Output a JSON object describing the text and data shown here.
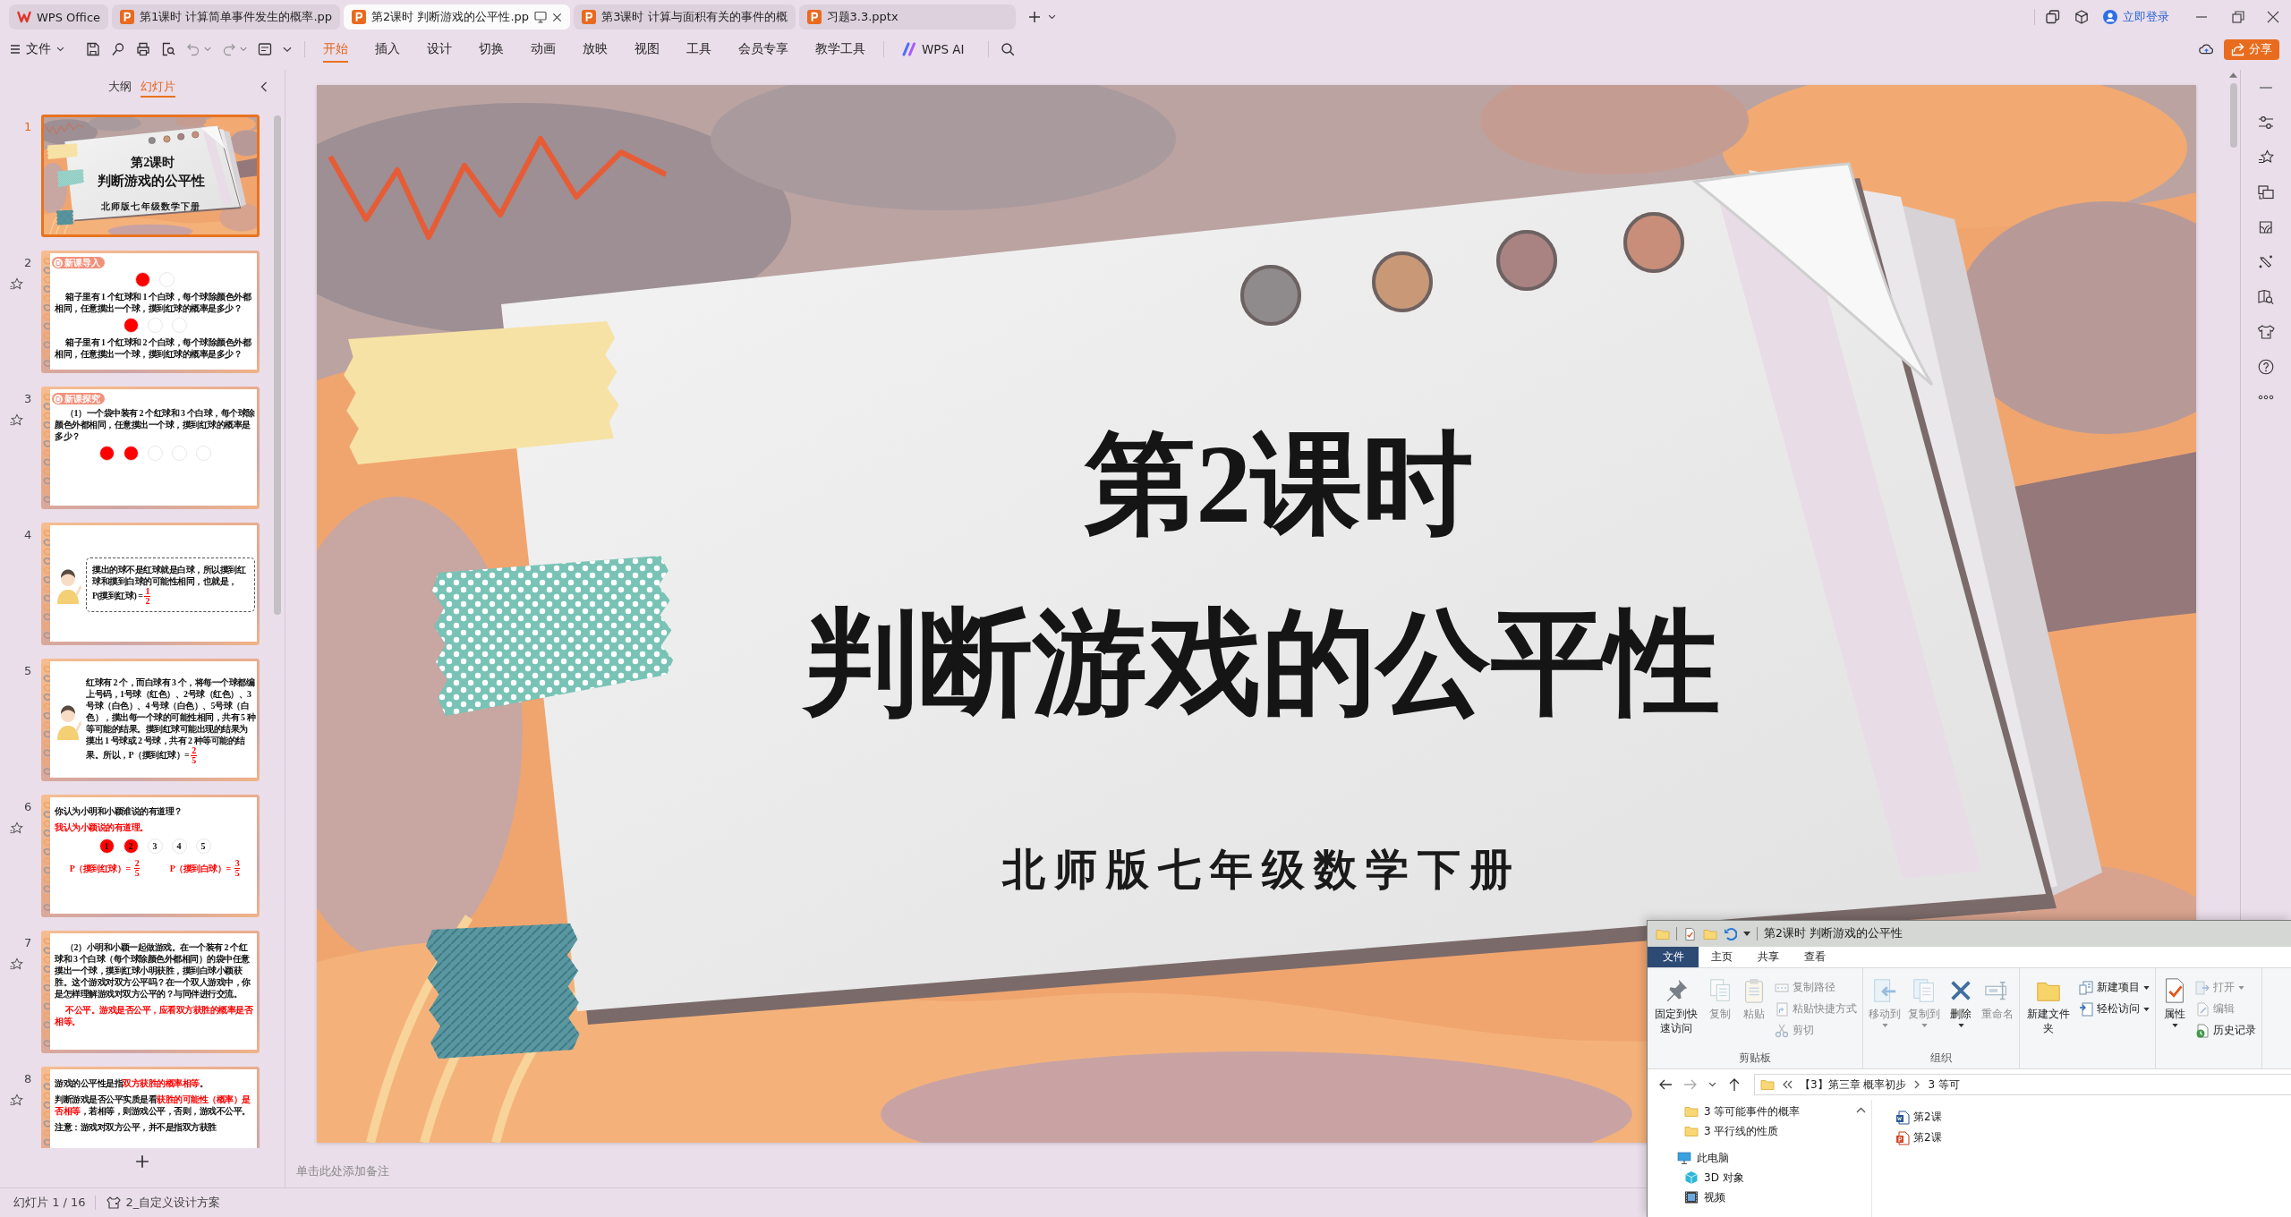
{
  "document_tabs": [
    {
      "kind": "home",
      "label": "WPS Office",
      "selected": false
    },
    {
      "kind": "document",
      "label": "第1课时 计算简单事件发生的概率.pp",
      "selected": false
    },
    {
      "kind": "document",
      "label": "第2课时 判断游戏的公平性.pp",
      "selected": true
    },
    {
      "kind": "document",
      "label": "第3课时 计算与面积有关的事件的概",
      "selected": false
    },
    {
      "kind": "document",
      "label": "习题3.3.pptx",
      "selected": false
    }
  ],
  "account": {
    "login": "立即登录"
  },
  "toolbar": {
    "file_menu": "文件",
    "ribbon_tabs": [
      {
        "label": "开始",
        "selected": true
      },
      {
        "label": "插入",
        "selected": false
      },
      {
        "label": "设计",
        "selected": false
      },
      {
        "label": "切换",
        "selected": false
      },
      {
        "label": "动画",
        "selected": false
      },
      {
        "label": "放映",
        "selected": false
      },
      {
        "label": "视图",
        "selected": false
      },
      {
        "label": "工具",
        "selected": false
      },
      {
        "label": "会员专享",
        "selected": false
      },
      {
        "label": "教学工具",
        "selected": false
      }
    ],
    "ai_button": "WPS AI",
    "share_button": "分享"
  },
  "sidebar": {
    "view_tabs": [
      {
        "label": "大纲",
        "selected": false
      },
      {
        "label": "幻灯片",
        "selected": true
      }
    ],
    "slides": [
      {
        "number": "1",
        "selected": true,
        "star": false,
        "kind": "cover",
        "title": "第2课时",
        "subtitle": "判断游戏的公平性",
        "caption": "北师版七年级数学下册"
      },
      {
        "number": "2",
        "selected": false,
        "star": true,
        "kind": "blocks",
        "tag": "新课导入",
        "blocks": [
          {
            "kind": "balls",
            "balls": [
              {
                "color": "#ff0000"
              },
              {
                "color": "#ffffff"
              }
            ]
          },
          {
            "kind": "paragraph",
            "indent": true,
            "text": "箱子里有 1 个红球和 1 个白球，每个球除颜色外都相同，任意摸出一个球，摸到红球的概率是多少？"
          },
          {
            "kind": "balls",
            "balls": [
              {
                "color": "#ff0000"
              },
              {
                "color": "#ffffff"
              },
              {
                "color": "#ffffff"
              }
            ]
          },
          {
            "kind": "paragraph",
            "indent": true,
            "text": "箱子里有 1 个红球和 2 个白球，每个球除颜色外都相同，任意摸出一个球，摸到红球的概率是多少？"
          }
        ]
      },
      {
        "number": "3",
        "selected": false,
        "star": true,
        "kind": "blocks",
        "tag": "新课探究",
        "blocks": [
          {
            "kind": "paragraph",
            "indent": true,
            "text": "（1）一个袋中装有 2 个红球和 3 个白球，每个球除颜色外都相同，任意摸出一个球，摸到红球的概率是多少？"
          },
          {
            "kind": "balls",
            "balls": [
              {
                "color": "#ff0000"
              },
              {
                "color": "#ff0000"
              },
              {
                "color": "#ffffff"
              },
              {
                "color": "#ffffff"
              },
              {
                "color": "#ffffff"
              }
            ]
          }
        ]
      },
      {
        "number": "4",
        "selected": false,
        "star": false,
        "kind": "speaker",
        "boxed": true,
        "text": "摸出的球不是红球就是白球，所以摸到红球和摸到白球的可能性相同，也就是，P(摸到红球) =",
        "fraction": {
          "numerator": "1",
          "denominator": "2"
        }
      },
      {
        "number": "5",
        "selected": false,
        "star": false,
        "kind": "speaker",
        "boxed": false,
        "text": "红球有 2 个，而白球有 3 个，将每一个球都编上号码，1号球（红色）、2号球（红色）、3号球（白色）、4 号球（白色）、5号球（白色），摸出每一个球的可能性相同，共有 5 种等可能的结果。摸到红球可能出现的结果为摸出 1 号球或 2 号球，共有 2 种等可能的结果。所以，P（摸到红球）=",
        "fraction": {
          "numerator": "2",
          "denominator": "5"
        }
      },
      {
        "number": "6",
        "selected": false,
        "star": true,
        "kind": "blocks",
        "blocks": [
          {
            "kind": "paragraph",
            "indent": false,
            "text": "你认为小明和小颖谁说的有道理？"
          },
          {
            "kind": "answer",
            "indent": false,
            "text": "我认为小颖说的有道理。"
          },
          {
            "kind": "balls",
            "balls": [
              {
                "color": "#ff0000",
                "label": "1"
              },
              {
                "color": "#ff0000",
                "label": "2"
              },
              {
                "color": "#ffffff",
                "label": "3"
              },
              {
                "color": "#ffffff",
                "label": "4"
              },
              {
                "color": "#ffffff",
                "label": "5"
              }
            ]
          },
          {
            "kind": "formulas",
            "items": [
              {
                "text": "P（摸到红球）=",
                "numerator": "2",
                "denominator": "5"
              },
              {
                "text": "P（摸到白球）=",
                "numerator": "3",
                "denominator": "5"
              }
            ]
          }
        ]
      },
      {
        "number": "7",
        "selected": false,
        "star": true,
        "kind": "blocks",
        "blocks": [
          {
            "kind": "paragraph",
            "indent": true,
            "text": "（2）小明和小颖一起做游戏。在一个装有 2 个红球和 3 个白球（每个球除颜色外都相同）的袋中任意摸出一个球，摸到红球小明获胜，摸到白球小颖获胜。这个游戏对双方公平吗？在一个双人游戏中，你是怎样理解游戏对双方公平的？与同伴进行交流。"
          },
          {
            "kind": "answer",
            "indent": true,
            "text": "不公平。游戏是否公平，应看双方获胜的概率是否相等。"
          }
        ]
      },
      {
        "number": "8",
        "selected": false,
        "star": true,
        "kind": "blocks",
        "blocks": [
          {
            "kind": "paragraph",
            "indent": false,
            "text": "游戏的公平性是指**双方获胜的概率相等**。"
          },
          {
            "kind": "paragraph",
            "indent": false,
            "text": "判断游戏是否公平实质是看**获胜的可能性（概率）是否相等**，若相等，则游戏公平，否则，游戏不公平。"
          },
          {
            "kind": "paragraph",
            "indent": false,
            "text": "注意：游戏对双方公平，并不是指双方获胜"
          }
        ]
      }
    ]
  },
  "slide": {
    "title": "第2课时",
    "subtitle": "判断游戏的公平性",
    "caption": "北师版七年级数学下册"
  },
  "notes": {
    "placeholder": "单击此处添加备注"
  },
  "status_bar": {
    "slide_counter": "幻灯片 1 / 16",
    "design_scheme": "2_自定义设计方案"
  },
  "file_explorer": {
    "title": "第2课时 判断游戏的公平性",
    "menu_tabs": [
      {
        "kind": "file",
        "label": "文件"
      },
      {
        "kind": "tab",
        "label": "主页"
      },
      {
        "kind": "tab",
        "label": "共享"
      },
      {
        "kind": "tab",
        "label": "查看"
      }
    ],
    "ribbon_groups": [
      {
        "label": "剪贴板",
        "commands": [
          {
            "kind": "large",
            "label": "固定到快速访问",
            "disabled": false,
            "dropdown": false
          },
          {
            "kind": "large",
            "label": "复制",
            "disabled": true,
            "dropdown": false
          },
          {
            "kind": "large",
            "label": "粘贴",
            "disabled": true,
            "dropdown": false
          },
          {
            "kind": "small",
            "label": "复制路径",
            "disabled": true,
            "dropdown": false
          },
          {
            "kind": "small",
            "label": "粘贴快捷方式",
            "disabled": true,
            "dropdown": false
          },
          {
            "kind": "small",
            "label": "剪切",
            "disabled": true,
            "dropdown": false
          }
        ]
      },
      {
        "label": "组织",
        "commands": [
          {
            "kind": "large",
            "label": "移动到",
            "disabled": true,
            "dropdown": true
          },
          {
            "kind": "large",
            "label": "复制到",
            "disabled": true,
            "dropdown": true
          },
          {
            "kind": "large",
            "label": "删除",
            "disabled": false,
            "dropdown": true
          },
          {
            "kind": "large",
            "label": "重命名",
            "disabled": true,
            "dropdown": false
          }
        ]
      },
      {
        "commands": [
          {
            "kind": "large",
            "label": "新建文件夹",
            "disabled": false,
            "dropdown": false
          },
          {
            "kind": "small",
            "label": "新建项目",
            "disabled": false,
            "dropdown": true
          },
          {
            "kind": "small",
            "label": "轻松访问",
            "disabled": false,
            "dropdown": true
          }
        ]
      },
      {
        "commands": [
          {
            "kind": "large",
            "label": "属性",
            "disabled": false,
            "dropdown": true
          },
          {
            "kind": "small",
            "label": "打开",
            "disabled": true,
            "dropdown": true
          },
          {
            "kind": "small",
            "label": "编辑",
            "disabled": true,
            "dropdown": false
          },
          {
            "kind": "small",
            "label": "历史记录",
            "disabled": false,
            "dropdown": false
          }
        ]
      }
    ],
    "address": {
      "path": [
        "【3】第三章 概率初步",
        "3 等可"
      ]
    },
    "navigation": [
      {
        "kind": "folder",
        "label": "3 等可能事件的概率"
      },
      {
        "kind": "folder",
        "label": "3 平行线的性质"
      },
      {
        "kind": "computer",
        "label": "此电脑",
        "children": [
          {
            "kind": "objects",
            "label": "3D 对象"
          },
          {
            "kind": "videos",
            "label": "视频"
          }
        ]
      }
    ],
    "files": [
      {
        "kind": "word",
        "name": "第2课"
      },
      {
        "kind": "presentation",
        "name": "第2课"
      }
    ]
  }
}
